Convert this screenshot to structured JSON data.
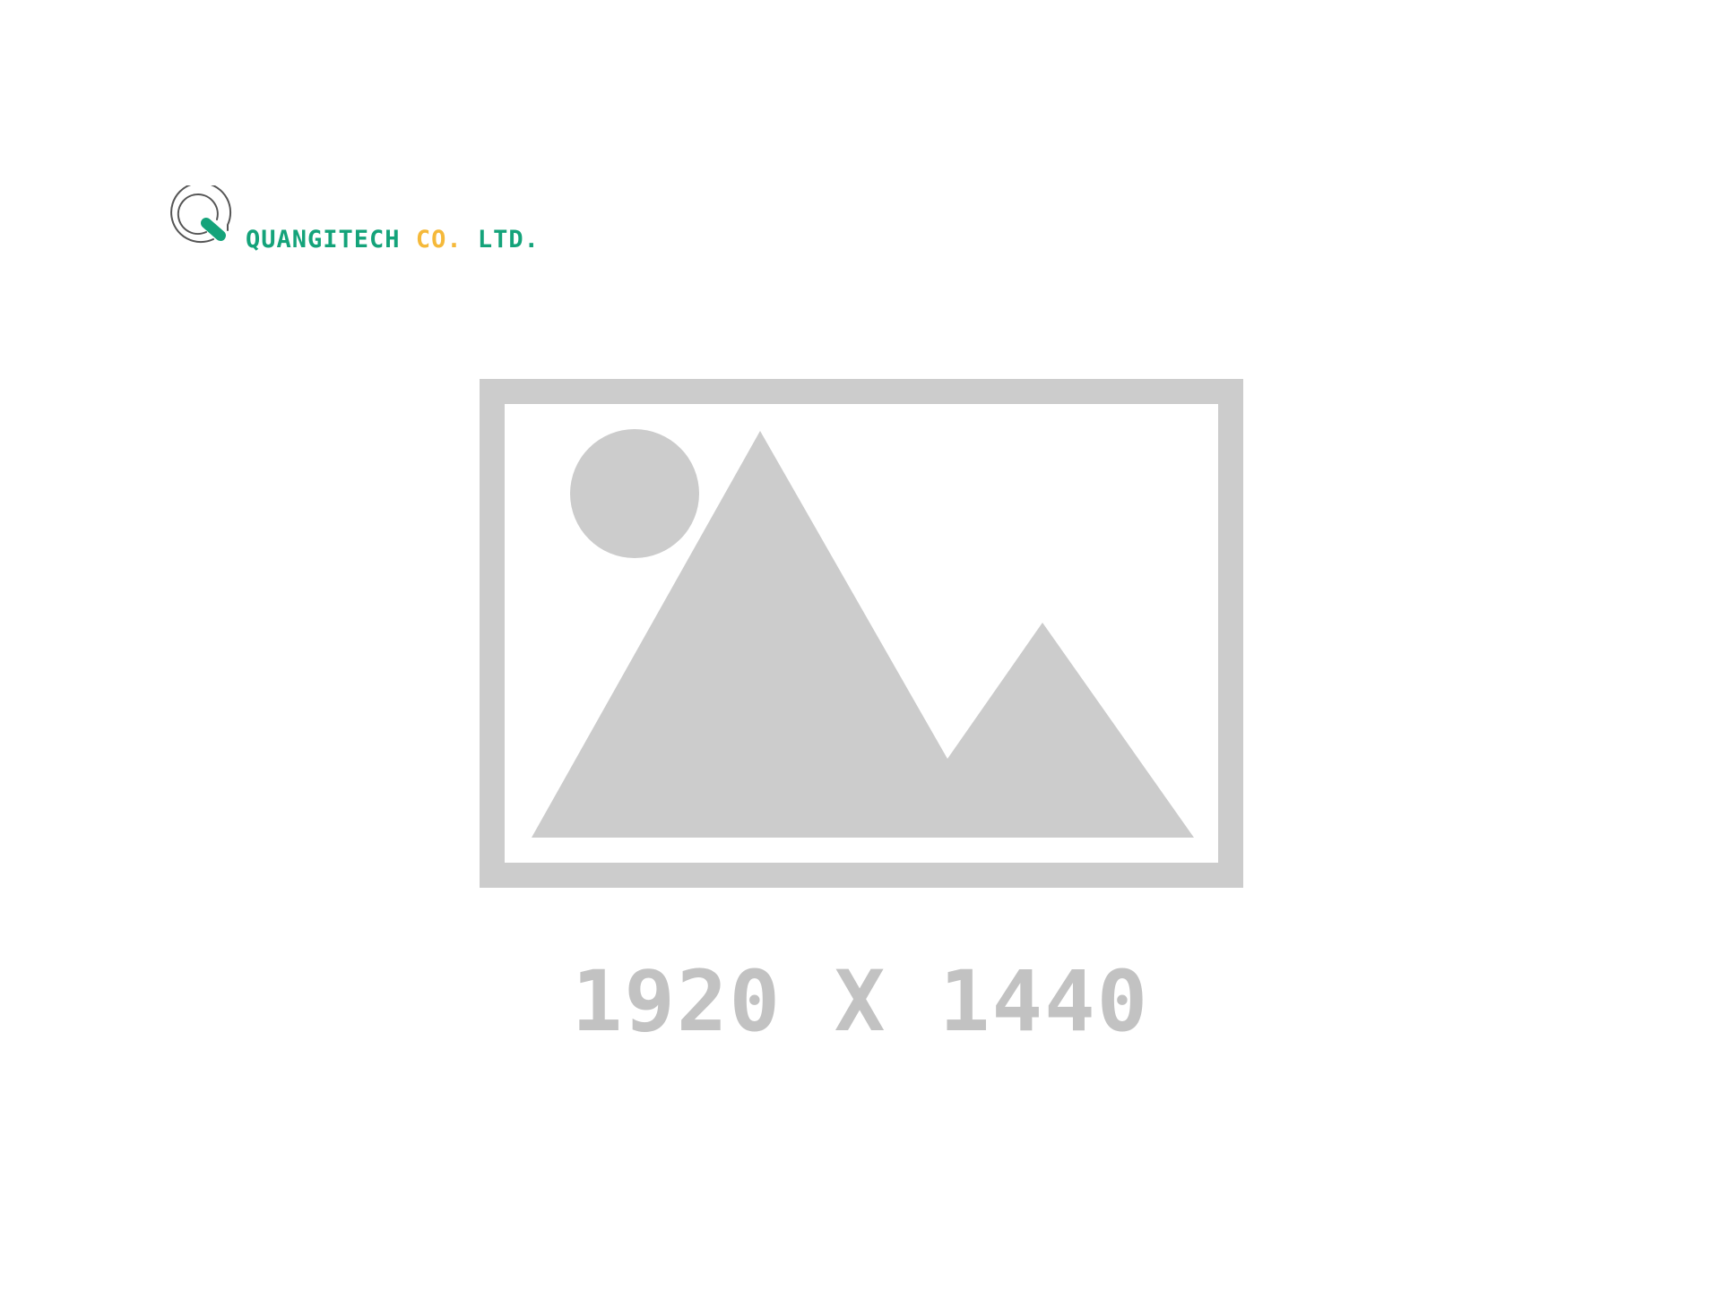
{
  "logo": {
    "name": "QUANGITECH",
    "co": "CO.",
    "ltd": "LTD.",
    "colors": {
      "green": "#14a37a",
      "orange": "#f5b93a",
      "outline": "#555555"
    }
  },
  "placeholder": {
    "icon": "image-placeholder-icon",
    "color": "#cccccc",
    "caption": "1920 X 1440"
  }
}
